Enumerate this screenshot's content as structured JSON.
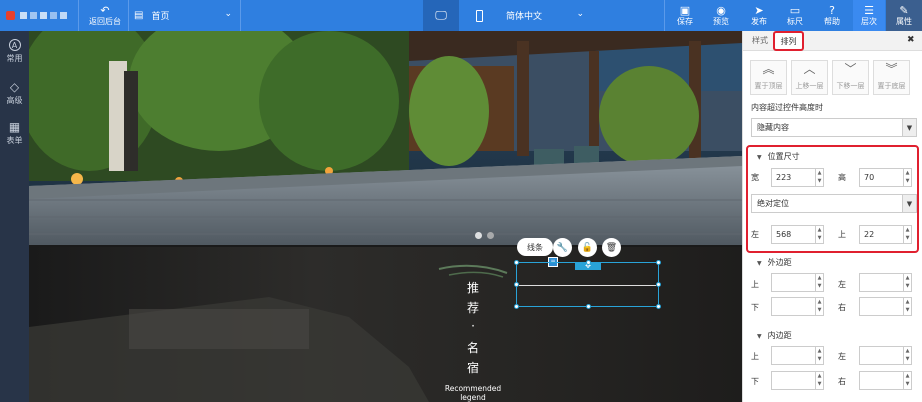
{
  "topbar": {
    "back_label": "返回后台",
    "home_label": "首页",
    "language": "简体中文",
    "actions": [
      {
        "icon": "save-icon",
        "label": "保存"
      },
      {
        "icon": "preview-icon",
        "label": "预览"
      },
      {
        "icon": "publish-icon",
        "label": "发布"
      },
      {
        "icon": "ruler-icon",
        "label": "标尺"
      },
      {
        "icon": "help-icon",
        "label": "帮助"
      },
      {
        "icon": "layers-icon",
        "label": "层次"
      },
      {
        "icon": "properties-icon",
        "label": "属性"
      }
    ]
  },
  "left_sidebar": [
    {
      "icon": "a-icon",
      "glyph": "A",
      "label": "常用"
    },
    {
      "icon": "diamond-icon",
      "glyph": "◇",
      "label": "高级"
    },
    {
      "icon": "grid-icon",
      "glyph": "▦",
      "label": "表单"
    }
  ],
  "canvas": {
    "headline": [
      "推",
      "荐",
      "·",
      "名",
      "宿"
    ],
    "english_line1": "Recommended",
    "english_line2": "legend",
    "toolbar_label": "线条"
  },
  "panel": {
    "tab_style": "样式",
    "tab_arrange": "排列",
    "close": "✖",
    "arrange_buttons": [
      "置于顶层",
      "上移一层",
      "下移一层",
      "置于底层"
    ],
    "overflow_label": "内容超过控件高度时",
    "overflow_value": "隐藏内容",
    "position_section": "位置尺寸",
    "width_label": "宽",
    "width_value": "223",
    "height_label": "高",
    "height_value": "70",
    "positioning": "绝对定位",
    "left_label": "左",
    "left_value": "568",
    "top_label": "上",
    "top_value": "22",
    "margin_section": "外边距",
    "padding_section": "内边距",
    "side_top": "上",
    "side_left": "左",
    "side_bottom": "下",
    "side_right": "右"
  },
  "colors": {
    "topbar": "#2f7fe0",
    "highlight": "#e0202f",
    "selection": "#29a3d8"
  }
}
